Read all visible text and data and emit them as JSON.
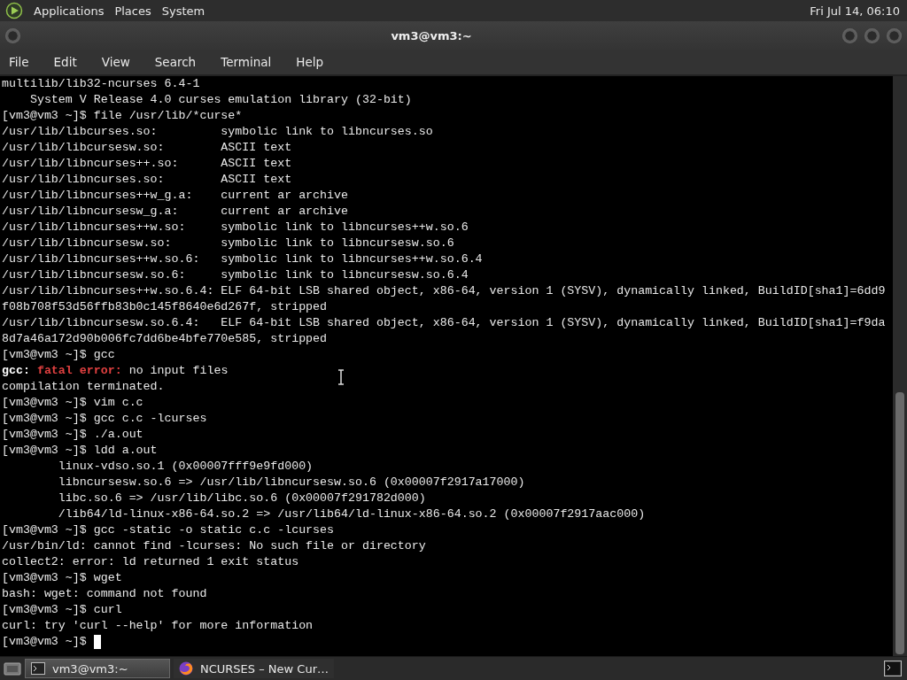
{
  "top_panel": {
    "menus": [
      "Applications",
      "Places",
      "System"
    ],
    "clock": "Fri Jul 14, 06:10"
  },
  "window": {
    "title": "vm3@vm3:~"
  },
  "menu_bar": [
    "File",
    "Edit",
    "View",
    "Search",
    "Terminal",
    "Help"
  ],
  "terminal": {
    "lines": [
      {
        "text": "multilib/lib32-ncurses 6.4-1"
      },
      {
        "text": "    System V Release 4.0 curses emulation library (32-bit)"
      },
      {
        "text": "[vm3@vm3 ~]$ file /usr/lib/*curse*"
      },
      {
        "text": "/usr/lib/libcurses.so:         symbolic link to libncurses.so"
      },
      {
        "text": "/usr/lib/libcursesw.so:        ASCII text"
      },
      {
        "text": "/usr/lib/libncurses++.so:      ASCII text"
      },
      {
        "text": "/usr/lib/libncurses.so:        ASCII text"
      },
      {
        "text": "/usr/lib/libncurses++w_g.a:    current ar archive"
      },
      {
        "text": "/usr/lib/libncursesw_g.a:      current ar archive"
      },
      {
        "text": "/usr/lib/libncurses++w.so:     symbolic link to libncurses++w.so.6"
      },
      {
        "text": "/usr/lib/libncursesw.so:       symbolic link to libncursesw.so.6"
      },
      {
        "text": "/usr/lib/libncurses++w.so.6:   symbolic link to libncurses++w.so.6.4"
      },
      {
        "text": "/usr/lib/libncursesw.so.6:     symbolic link to libncursesw.so.6.4"
      },
      {
        "text": "/usr/lib/libncurses++w.so.6.4: ELF 64-bit LSB shared object, x86-64, version 1 (SYSV), dynamically linked, BuildID[sha1]=6dd9"
      },
      {
        "text": "f08b708f53d56ffb83b0c145f8640e6d267f, stripped"
      },
      {
        "text": "/usr/lib/libncursesw.so.6.4:   ELF 64-bit LSB shared object, x86-64, version 1 (SYSV), dynamically linked, BuildID[sha1]=f9da"
      },
      {
        "text": "8d7a46a172d90b006fc7dd6be4bfe770e585, stripped"
      },
      {
        "text": "[vm3@vm3 ~]$ gcc"
      },
      {
        "segments": [
          {
            "kind": "bold",
            "text": "gcc: "
          },
          {
            "kind": "error",
            "text": "fatal error:"
          },
          {
            "kind": "plain",
            "text": " no input files"
          }
        ]
      },
      {
        "text": "compilation terminated."
      },
      {
        "text": "[vm3@vm3 ~]$ vim c.c"
      },
      {
        "text": "[vm3@vm3 ~]$ gcc c.c -lcurses"
      },
      {
        "text": "[vm3@vm3 ~]$ ./a.out"
      },
      {
        "text": "[vm3@vm3 ~]$ ldd a.out"
      },
      {
        "text": "        linux-vdso.so.1 (0x00007fff9e9fd000)"
      },
      {
        "text": "        libncursesw.so.6 => /usr/lib/libncursesw.so.6 (0x00007f2917a17000)"
      },
      {
        "text": "        libc.so.6 => /usr/lib/libc.so.6 (0x00007f291782d000)"
      },
      {
        "text": "        /lib64/ld-linux-x86-64.so.2 => /usr/lib64/ld-linux-x86-64.so.2 (0x00007f2917aac000)"
      },
      {
        "text": "[vm3@vm3 ~]$ gcc -static -o static c.c -lcurses"
      },
      {
        "text": "/usr/bin/ld: cannot find -lcurses: No such file or directory"
      },
      {
        "text": "collect2: error: ld returned 1 exit status"
      },
      {
        "text": "[vm3@vm3 ~]$ wget"
      },
      {
        "text": "bash: wget: command not found"
      },
      {
        "text": "[vm3@vm3 ~]$ curl"
      },
      {
        "text": "curl: try 'curl --help' for more information"
      },
      {
        "text": "[vm3@vm3 ~]$ ",
        "cursor": true
      }
    ]
  },
  "taskbar": {
    "tasks": [
      {
        "label": "vm3@vm3:~",
        "selected": true,
        "kind": "terminal"
      },
      {
        "label": "NCURSES – New Cur…",
        "selected": false,
        "kind": "browser"
      }
    ]
  }
}
